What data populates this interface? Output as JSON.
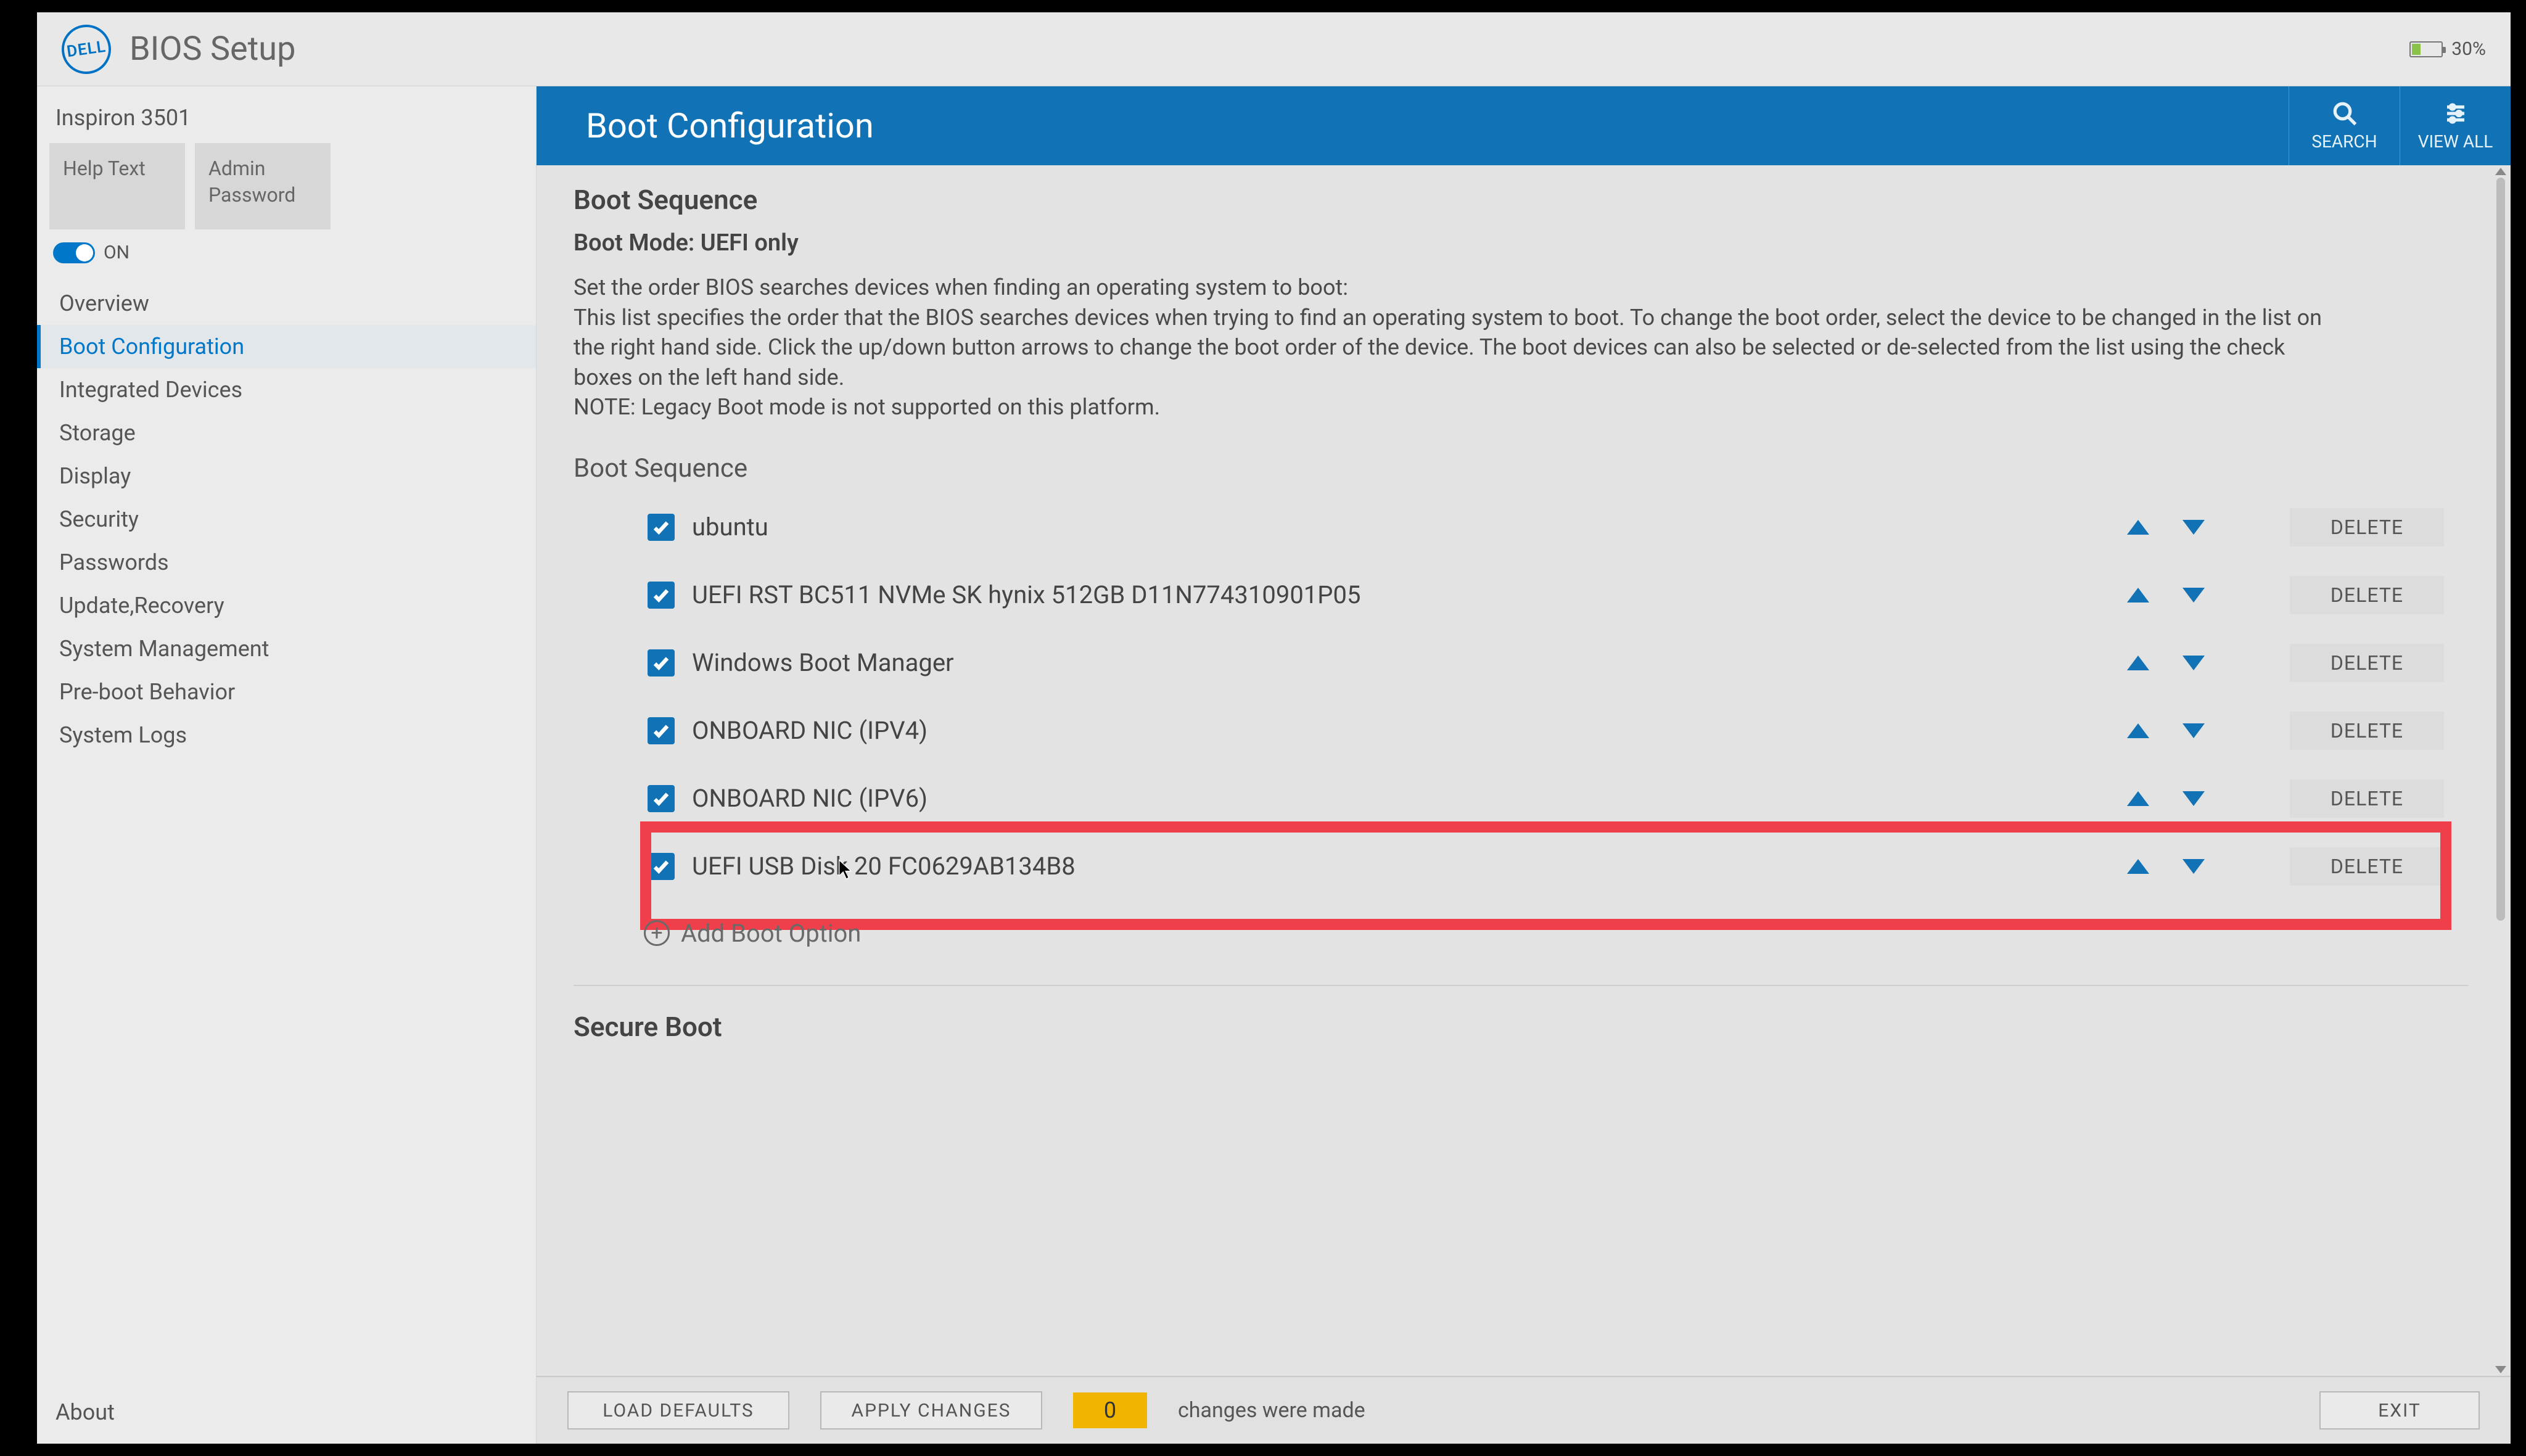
{
  "header": {
    "logo_text": "DELL",
    "title": "BIOS Setup",
    "battery_pct": "30%"
  },
  "sidebar": {
    "model": "Inspiron 3501",
    "help_text_label": "Help Text",
    "admin_password_label": "Admin\nPassword",
    "toggle_label": "ON",
    "nav": [
      "Overview",
      "Boot Configuration",
      "Integrated Devices",
      "Storage",
      "Display",
      "Security",
      "Passwords",
      "Update,Recovery",
      "System Management",
      "Pre-boot Behavior",
      "System Logs"
    ],
    "active_index": 1,
    "about_label": "About"
  },
  "titlebar": {
    "page_title": "Boot Configuration",
    "search_label": "SEARCH",
    "viewall_label": "VIEW ALL"
  },
  "content": {
    "section_heading": "Boot Sequence",
    "boot_mode": "Boot Mode: UEFI only",
    "description_line1": "Set the order BIOS searches devices when finding an operating system to boot:",
    "description_line2": "This list specifies the order that the BIOS searches devices when trying to find an operating system to boot.  To change the boot order, select the device to be changed in the list on the right hand side.  Click the up/down button arrows to change the boot order of the device.  The boot devices can also be selected or de-selected from the list using the check boxes on the left hand side.",
    "description_line3": "NOTE: Legacy Boot mode is not supported on this platform.",
    "subheading": "Boot Sequence",
    "delete_label": "DELETE",
    "add_boot_label": "Add Boot Option",
    "boot_items": [
      {
        "label": "ubuntu",
        "highlighted": false
      },
      {
        "label": "UEFI RST BC511 NVMe SK hynix 512GB D11N774310901P05",
        "highlighted": false
      },
      {
        "label": "Windows Boot Manager",
        "highlighted": false
      },
      {
        "label": "ONBOARD NIC (IPV4)",
        "highlighted": false
      },
      {
        "label": "ONBOARD NIC (IPV6)",
        "highlighted": false
      },
      {
        "label": "UEFI USB Disk 20 FC0629AB134B8",
        "highlighted": true
      }
    ],
    "secure_boot_heading": "Secure Boot"
  },
  "footer": {
    "load_defaults": "LOAD DEFAULTS",
    "apply_changes": "APPLY CHANGES",
    "change_count": "0",
    "change_text": "changes were made",
    "exit_label": "EXIT"
  }
}
